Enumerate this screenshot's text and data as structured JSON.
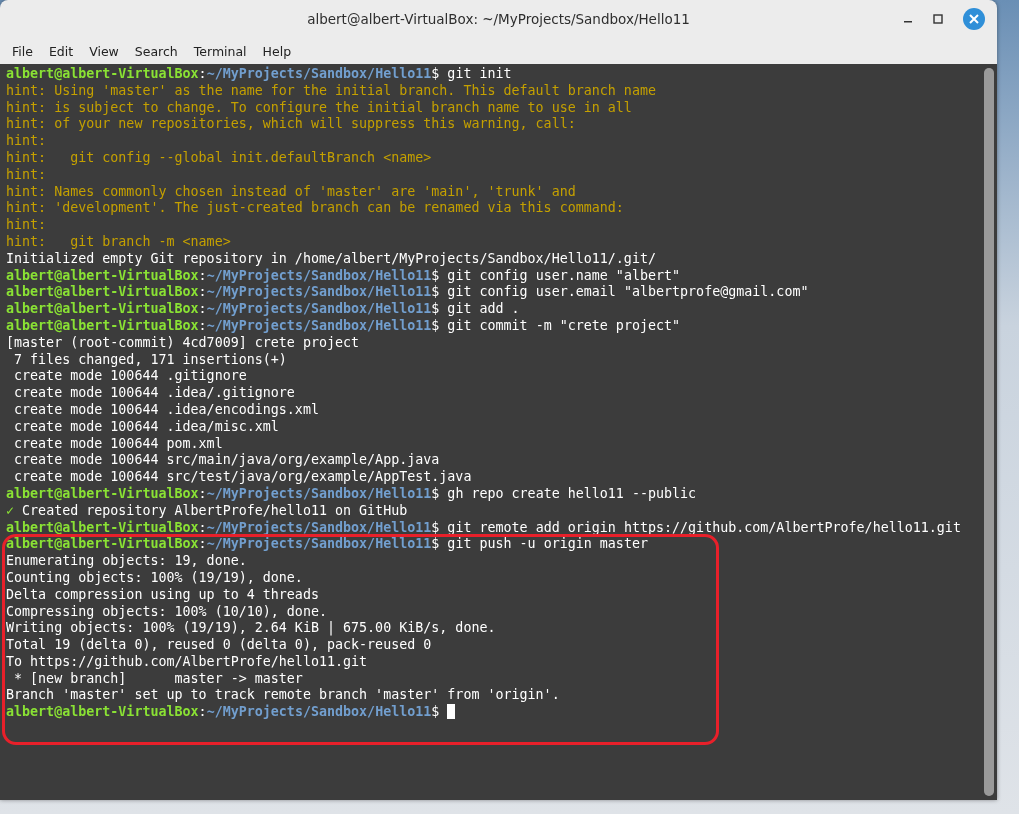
{
  "window": {
    "title": "albert@albert-VirtualBox: ~/MyProjects/Sandbox/Hello11"
  },
  "menu": [
    "File",
    "Edit",
    "View",
    "Search",
    "Terminal",
    "Help"
  ],
  "terminal": {
    "lines": [
      {
        "kind": "prompt",
        "user_host": "albert@albert-VirtualBox",
        "separator": ":",
        "path": "~/MyProjects/Sandbox/Hello11",
        "command": "$ git init"
      },
      {
        "kind": "hint",
        "text": "hint: Using 'master' as the name for the initial branch. This default branch name"
      },
      {
        "kind": "hint",
        "text": "hint: is subject to change. To configure the initial branch name to use in all"
      },
      {
        "kind": "hint",
        "text": "hint: of your new repositories, which will suppress this warning, call:"
      },
      {
        "kind": "hint",
        "text": "hint:"
      },
      {
        "kind": "hint",
        "text": "hint:   git config --global init.defaultBranch <name>"
      },
      {
        "kind": "hint",
        "text": "hint:"
      },
      {
        "kind": "hint",
        "text": "hint: Names commonly chosen instead of 'master' are 'main', 'trunk' and"
      },
      {
        "kind": "hint",
        "text": "hint: 'development'. The just-created branch can be renamed via this command:"
      },
      {
        "kind": "hint",
        "text": "hint:"
      },
      {
        "kind": "hint",
        "text": "hint:   git branch -m <name>"
      },
      {
        "kind": "output",
        "text": "Initialized empty Git repository in /home/albert/MyProjects/Sandbox/Hello11/.git/"
      },
      {
        "kind": "prompt",
        "user_host": "albert@albert-VirtualBox",
        "separator": ":",
        "path": "~/MyProjects/Sandbox/Hello11",
        "command": "$ git config user.name \"albert\""
      },
      {
        "kind": "prompt",
        "user_host": "albert@albert-VirtualBox",
        "separator": ":",
        "path": "~/MyProjects/Sandbox/Hello11",
        "command": "$ git config user.email \"albertprofe@gmail.com\""
      },
      {
        "kind": "prompt",
        "user_host": "albert@albert-VirtualBox",
        "separator": ":",
        "path": "~/MyProjects/Sandbox/Hello11",
        "command": "$ git add ."
      },
      {
        "kind": "prompt",
        "user_host": "albert@albert-VirtualBox",
        "separator": ":",
        "path": "~/MyProjects/Sandbox/Hello11",
        "command": "$ git commit -m \"crete project\""
      },
      {
        "kind": "output",
        "text": "[master (root-commit) 4cd7009] crete project"
      },
      {
        "kind": "output",
        "text": " 7 files changed, 171 insertions(+)"
      },
      {
        "kind": "output",
        "text": " create mode 100644 .gitignore"
      },
      {
        "kind": "output",
        "text": " create mode 100644 .idea/.gitignore"
      },
      {
        "kind": "output",
        "text": " create mode 100644 .idea/encodings.xml"
      },
      {
        "kind": "output",
        "text": " create mode 100644 .idea/misc.xml"
      },
      {
        "kind": "output",
        "text": " create mode 100644 pom.xml"
      },
      {
        "kind": "output",
        "text": " create mode 100644 src/main/java/org/example/App.java"
      },
      {
        "kind": "output",
        "text": " create mode 100644 src/test/java/org/example/AppTest.java"
      },
      {
        "kind": "prompt",
        "user_host": "albert@albert-VirtualBox",
        "separator": ":",
        "path": "~/MyProjects/Sandbox/Hello11",
        "command": "$ gh repo create hello11 --public"
      },
      {
        "kind": "success",
        "mark": "✓",
        "text": " Created repository AlbertProfe/hello11 on GitHub"
      },
      {
        "kind": "prompt",
        "user_host": "albert@albert-VirtualBox",
        "separator": ":",
        "path": "~/MyProjects/Sandbox/Hello11",
        "command": "$ git remote add origin https://github.com/AlbertProfe/hello11.git"
      }
    ],
    "highlighted_lines": [
      {
        "kind": "prompt",
        "user_host": "albert@albert-VirtualBox",
        "separator": ":",
        "path": "~/MyProjects/Sandbox/Hello11",
        "command": "$ git push -u origin master"
      },
      {
        "kind": "output",
        "text": "Enumerating objects: 19, done."
      },
      {
        "kind": "output",
        "text": "Counting objects: 100% (19/19), done."
      },
      {
        "kind": "output",
        "text": "Delta compression using up to 4 threads"
      },
      {
        "kind": "output",
        "text": "Compressing objects: 100% (10/10), done."
      },
      {
        "kind": "output",
        "text": "Writing objects: 100% (19/19), 2.64 KiB | 675.00 KiB/s, done."
      },
      {
        "kind": "output",
        "text": "Total 19 (delta 0), reused 0 (delta 0), pack-reused 0"
      },
      {
        "kind": "output",
        "text": "To https://github.com/AlbertProfe/hello11.git"
      },
      {
        "kind": "output",
        "text": " * [new branch]      master -> master"
      },
      {
        "kind": "output",
        "text": "Branch 'master' set up to track remote branch 'master' from 'origin'."
      },
      {
        "kind": "prompt",
        "user_host": "albert@albert-VirtualBox",
        "separator": ":",
        "path": "~/MyProjects/Sandbox/Hello11",
        "command": "$",
        "cursor": true
      }
    ]
  }
}
